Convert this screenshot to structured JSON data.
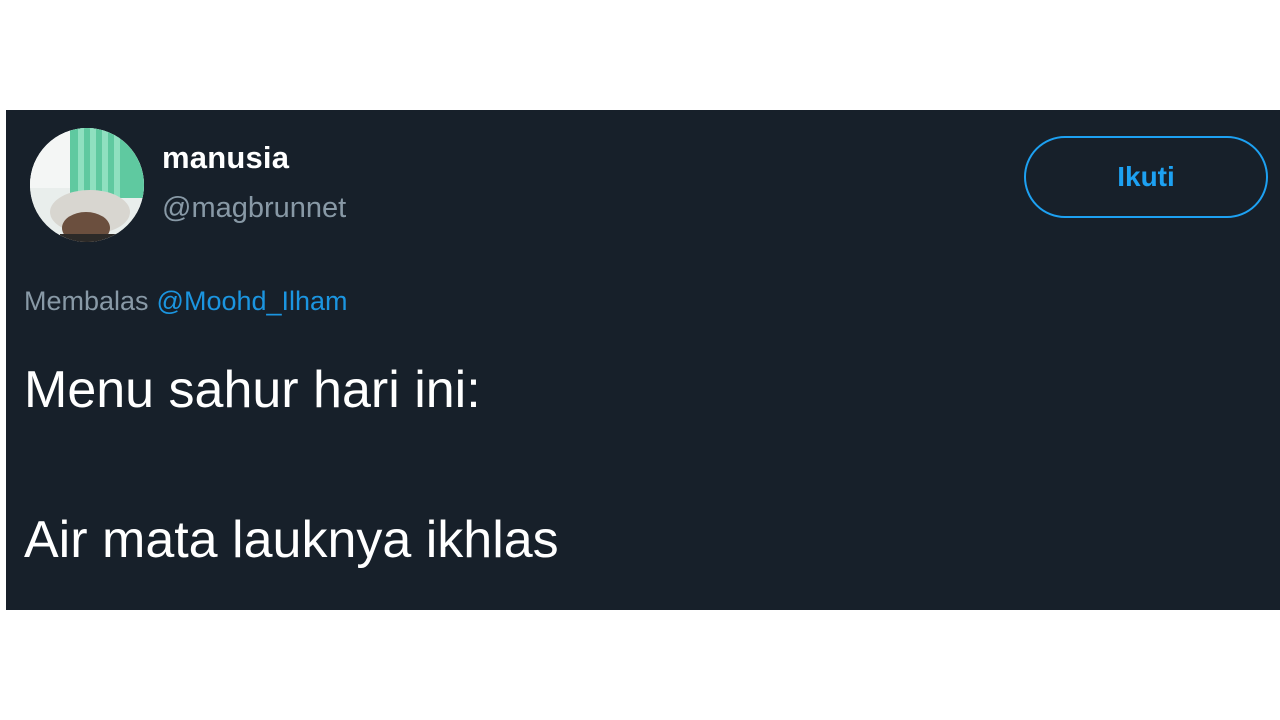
{
  "tweet": {
    "user": {
      "display_name": "manusia",
      "handle": "@magbrunnet",
      "avatar_icon": "profile-photo"
    },
    "follow_button_label": "Ikuti",
    "reply_context": {
      "label": "Membalas",
      "mention": "@Moohd_Ilham"
    },
    "text_lines": [
      "Menu sahur hari ini:",
      "Air mata lauknya ikhlas"
    ]
  },
  "colors": {
    "card_background": "#17202a",
    "accent": "#1da1f2",
    "secondary_text": "#8899a6",
    "primary_text": "#ffffff"
  }
}
